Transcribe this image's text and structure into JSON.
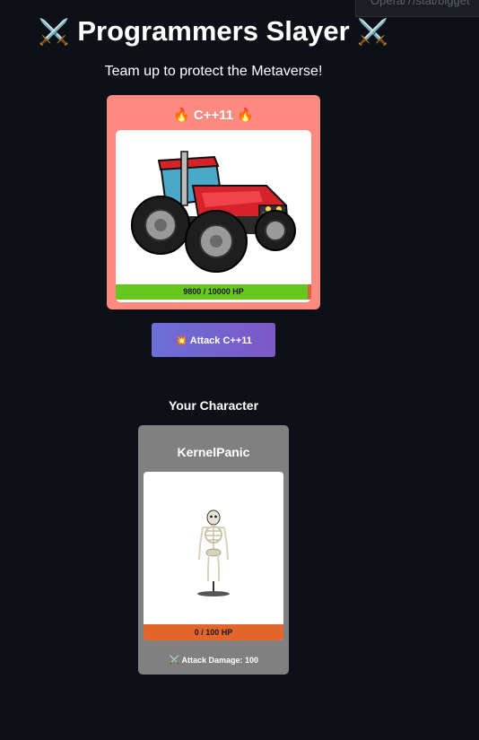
{
  "browser": {
    "url_fragment": "Opera/7/stat/bigget"
  },
  "header": {
    "icon_left": "⚔️",
    "title": "Programmers Slayer",
    "icon_right": "⚔️",
    "subtitle": "Team up to protect the Metaverse!"
  },
  "boss": {
    "icon": "🔥",
    "name": "C++11",
    "image": "tractor",
    "hp_text": "9800 / 10000 HP",
    "hp_fraction": 0.98
  },
  "attack_button": {
    "icon": "💥",
    "label": "Attack C++11"
  },
  "player_section": {
    "heading": "Your Character"
  },
  "player": {
    "name": "KernelPanic",
    "image": "skeleton",
    "hp_text": "0 / 100 HP",
    "hp_fraction": 0.0,
    "damage_icon": "⚔️",
    "damage_text": "Attack Damage: 100"
  },
  "colors": {
    "background": "#0d1117",
    "boss_card": "#ff8a7f",
    "player_card": "#808080",
    "hp_green": "#66c71f",
    "hp_orange": "#e2652b",
    "button_start": "#6b6fd6",
    "button_end": "#7d58c7"
  }
}
